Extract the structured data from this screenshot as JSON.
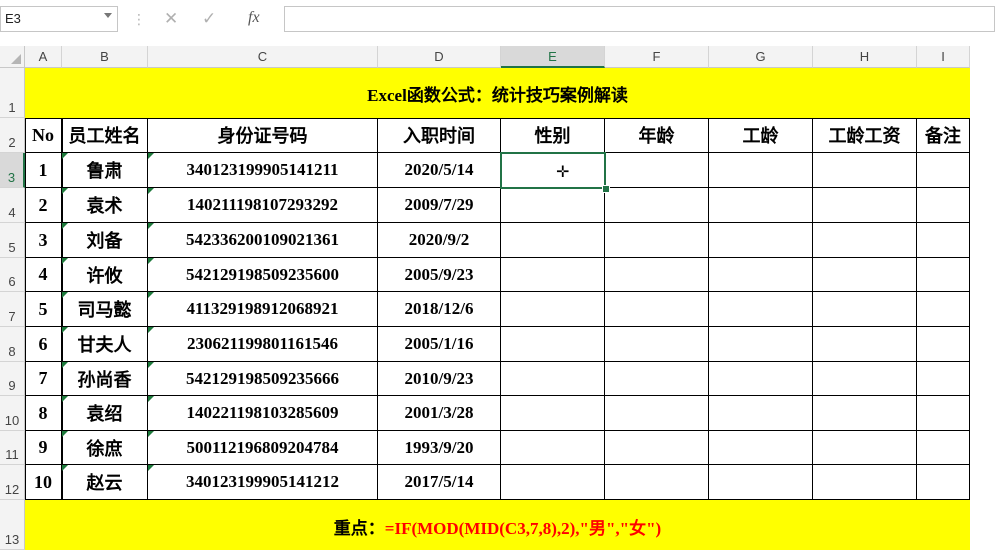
{
  "formula_bar": {
    "name_box": "E3",
    "fx_label": "fx",
    "cancel_icon": "✕",
    "confirm_icon": "✓",
    "formula": ""
  },
  "columns": [
    "A",
    "B",
    "C",
    "D",
    "E",
    "F",
    "G",
    "H",
    "I"
  ],
  "rows": [
    "1",
    "2",
    "3",
    "4",
    "5",
    "6",
    "7",
    "8",
    "9",
    "10",
    "11",
    "12",
    "13"
  ],
  "title": "Excel函数公式：统计技巧案例解读",
  "headers": [
    "No",
    "员工姓名",
    "身份证号码",
    "入职时间",
    "性别",
    "年龄",
    "工龄",
    "工龄工资",
    "备注"
  ],
  "records": [
    {
      "no": "1",
      "name": "鲁肃",
      "id": "340123199905141211",
      "date": "2020/5/14"
    },
    {
      "no": "2",
      "name": "袁术",
      "id": "140211198107293292",
      "date": "2009/7/29"
    },
    {
      "no": "3",
      "name": "刘备",
      "id": "542336200109021361",
      "date": "2020/9/2"
    },
    {
      "no": "4",
      "name": "许攸",
      "id": "542129198509235600",
      "date": "2005/9/23"
    },
    {
      "no": "5",
      "name": "司马懿",
      "id": "411329198912068921",
      "date": "2018/12/6"
    },
    {
      "no": "6",
      "name": "甘夫人",
      "id": "230621199801161546",
      "date": "2005/1/16"
    },
    {
      "no": "7",
      "name": "孙尚香",
      "id": "542129198509235666",
      "date": "2010/9/23"
    },
    {
      "no": "8",
      "name": "袁绍",
      "id": "140221198103285609",
      "date": "2001/3/28"
    },
    {
      "no": "9",
      "name": "徐庶",
      "id": "500112196809204784",
      "date": "1993/9/20"
    },
    {
      "no": "10",
      "name": "赵云",
      "id": "340123199905141212",
      "date": "2017/5/14"
    }
  ],
  "footer": {
    "label": "重点：",
    "formula": "=IF(MOD(MID(C3,7,8),2),\"男\",\"女\")"
  },
  "selected_cell": "E3"
}
